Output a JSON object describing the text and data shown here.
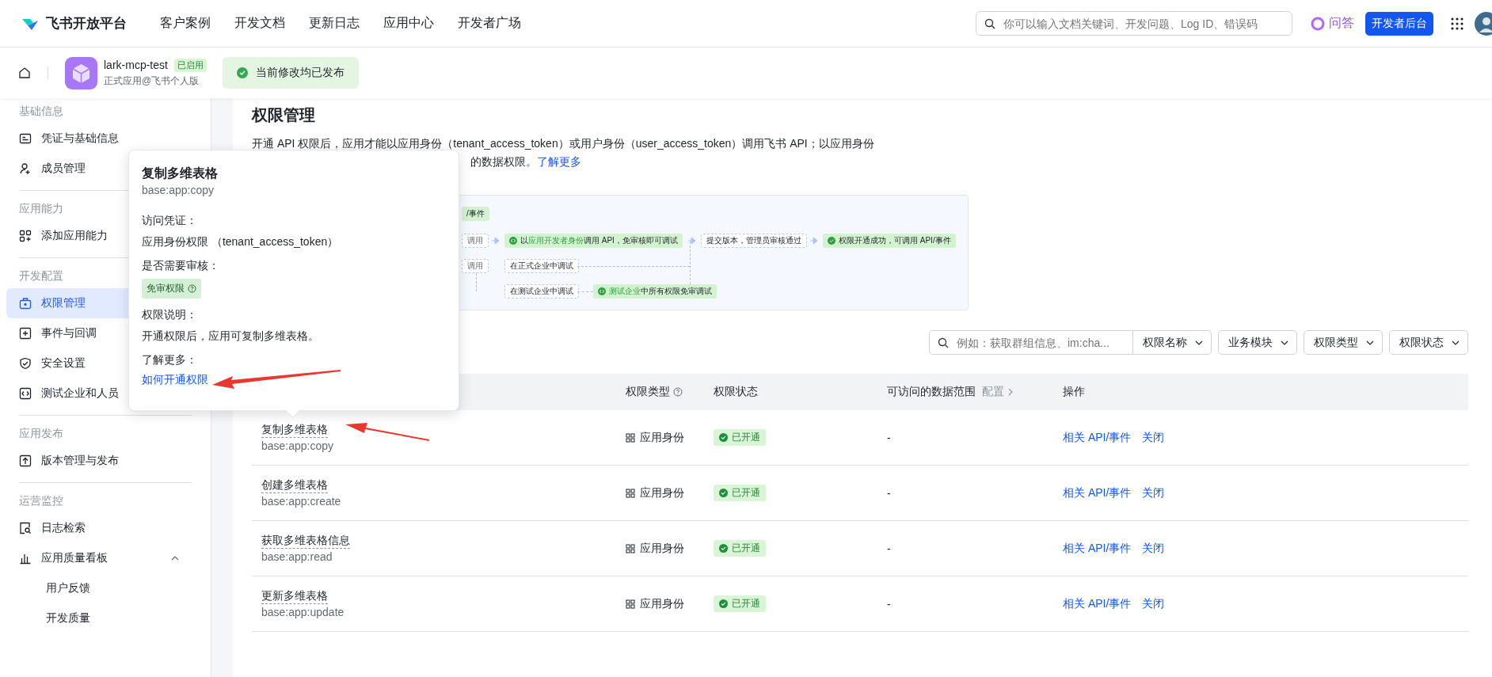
{
  "topbar": {
    "logo": "飞书开放平台",
    "nav": [
      "客户案例",
      "开发文档",
      "更新日志",
      "应用中心",
      "开发者广场"
    ],
    "search": {
      "placeholder": "你可以输入文档关键词、开发问题、Log ID、错误码"
    },
    "ask": "问答",
    "console_button": "开发者后台"
  },
  "app_bar": {
    "name": "lark-mcp-test",
    "badge": "已启用",
    "subtitle": "正式应用@飞书个人版",
    "notice": "当前修改均已发布"
  },
  "sidebar": {
    "sections": [
      {
        "title": "基础信息",
        "items": [
          {
            "label": "凭证与基础信息",
            "selected": false
          },
          {
            "label": "成员管理",
            "selected": false
          }
        ]
      },
      {
        "title": "应用能力",
        "items": [
          {
            "label": "添加应用能力",
            "selected": false
          }
        ]
      },
      {
        "title": "开发配置",
        "items": [
          {
            "label": "权限管理",
            "selected": true
          },
          {
            "label": "事件与回调",
            "selected": false
          },
          {
            "label": "安全设置",
            "selected": false
          },
          {
            "label": "测试企业和人员",
            "selected": false
          }
        ]
      },
      {
        "title": "应用发布",
        "items": [
          {
            "label": "版本管理与发布",
            "selected": false
          }
        ]
      },
      {
        "title": "运营监控",
        "items": [
          {
            "label": "日志检索",
            "selected": false
          },
          {
            "label": "应用质量看板",
            "selected": false,
            "expanded": true,
            "children": [
              {
                "label": "用户反馈",
                "selected": false
              },
              {
                "label": "开发质量",
                "selected": false
              }
            ]
          }
        ]
      }
    ]
  },
  "page": {
    "title": "权限管理",
    "description_line1": "开通 API 权限后，应用才能以应用身份（tenant_access_token）或用户身份（user_access_token）调用飞书 API；以应用身份",
    "description_line2": "的数据权限。",
    "learn_more": "了解更多"
  },
  "diagram": {
    "nodes": [
      {
        "text": "/事件",
        "kind": "result"
      },
      {
        "text": "调用",
        "kind": "source"
      },
      {
        "text": "以**应用开发者身份**调用 API，免审核即可调试",
        "kind": "result"
      },
      {
        "text": "提交版本，管理员审核通过",
        "kind": "step"
      },
      {
        "text": "权限开通成功，可调用 API/事件",
        "kind": "result"
      },
      {
        "text": "调用",
        "kind": "source"
      },
      {
        "text": "在正式企业中调试",
        "kind": "step"
      },
      {
        "text": "在测试企业中调试",
        "kind": "step"
      },
      {
        "text": "**测试企业**中所有权限免审调试",
        "kind": "result"
      }
    ]
  },
  "filters": {
    "search_placeholder": "例如：获取群组信息、im:cha...",
    "search_scope": "权限名称",
    "dropdowns": [
      "业务模块",
      "权限类型",
      "权限状态"
    ]
  },
  "table": {
    "columns": [
      "权限类型",
      "权限状态",
      "可访问的数据范围",
      "操作"
    ],
    "scope_link": "配置",
    "rows": [
      {
        "name": "复制多维表格",
        "code": "base:app:copy",
        "identity": "应用身份",
        "status": "已开通",
        "scope": "-",
        "actions": [
          "相关 API/事件",
          "关闭"
        ]
      },
      {
        "name": "创建多维表格",
        "code": "base:app:create",
        "identity": "应用身份",
        "status": "已开通",
        "scope": "-",
        "actions": [
          "相关 API/事件",
          "关闭"
        ]
      },
      {
        "name": "获取多维表格信息",
        "code": "base:app:read",
        "identity": "应用身份",
        "status": "已开通",
        "scope": "-",
        "actions": [
          "相关 API/事件",
          "关闭"
        ]
      },
      {
        "name": "更新多维表格",
        "code": "base:app:update",
        "identity": "应用身份",
        "status": "已开通",
        "scope": "-",
        "actions": [
          "相关 API/事件",
          "关闭"
        ]
      }
    ]
  },
  "tooltip": {
    "title": "复制多维表格",
    "code": "base:app:copy",
    "fields": [
      {
        "label": "访问凭证：",
        "value": "应用身份权限 （tenant_access_token）",
        "kind": "text"
      },
      {
        "label": "是否需要审核：",
        "value": "免审权限",
        "kind": "tag"
      },
      {
        "label": "权限说明：",
        "value": "开通权限后，应用可复制多维表格。",
        "kind": "text"
      },
      {
        "label": "了解更多：",
        "value": "如何开通权限",
        "kind": "link"
      }
    ]
  }
}
